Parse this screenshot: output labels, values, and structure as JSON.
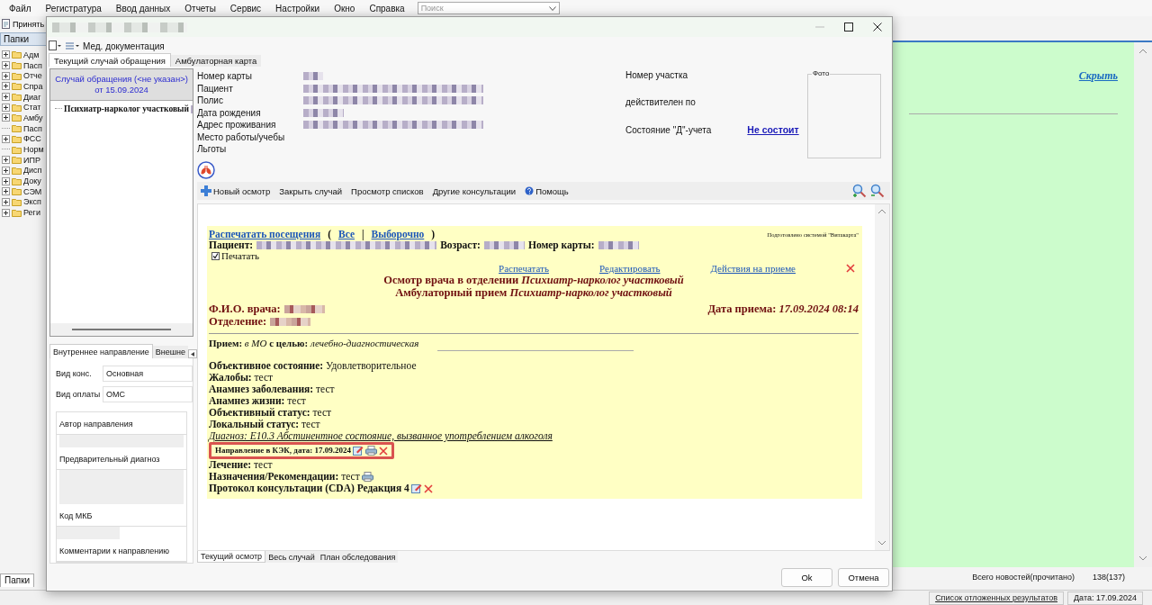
{
  "menu": [
    "Файл",
    "Регистратура",
    "Ввод данных",
    "Отчеты",
    "Сервис",
    "Настройки",
    "Окно",
    "Справка"
  ],
  "search": {
    "placeholder": "Поиск"
  },
  "toolbar": {
    "button": "Принять"
  },
  "folders": {
    "title": "Папки",
    "items": [
      {
        "label": "Адм",
        "expandable": true
      },
      {
        "label": "Пасп",
        "expandable": true
      },
      {
        "label": "Отче",
        "expandable": true
      },
      {
        "label": "Спра",
        "expandable": true
      },
      {
        "label": "Диаг",
        "expandable": true
      },
      {
        "label": "Стат",
        "expandable": true
      },
      {
        "label": "Амбу",
        "expandable": true
      },
      {
        "label": "Пасп",
        "expandable": false
      },
      {
        "label": "ФСС",
        "expandable": true
      },
      {
        "label": "Норм",
        "expandable": false
      },
      {
        "label": "ИПР",
        "expandable": true
      },
      {
        "label": "Дисп",
        "expandable": true
      },
      {
        "label": "Доку",
        "expandable": true
      },
      {
        "label": "СЭМ",
        "expandable": true
      },
      {
        "label": "Эксп",
        "expandable": true
      },
      {
        "label": "Реги",
        "expandable": true
      }
    ]
  },
  "news": {
    "hide_link": "Скрыть",
    "tab": "Папки",
    "total_label": "Всего новостей(прочитано)",
    "total": "138(137)"
  },
  "status_bar": {
    "link": "Список отложенных результатов",
    "date": "Дата: 17.09.2024"
  },
  "dialog": {
    "toolbar_label": "Мед. документация",
    "tabs": [
      {
        "label": "Текущий случай обращения",
        "selected": true
      },
      {
        "label": "Амбулаторная карта",
        "selected": false
      }
    ],
    "case": {
      "header": [
        "Случай обращения (<не указан>)",
        "от 15.09.2024"
      ],
      "item": "Психиатр-нарколог участковый"
    },
    "referral_tabs": [
      {
        "label": "Внутреннее направление",
        "selected": true
      },
      {
        "label": "Внешне",
        "selected": false
      }
    ],
    "referral_fields": [
      {
        "label": "Вид конс.",
        "value": "Основная"
      },
      {
        "label": "Вид оплаты",
        "value": "ОМС"
      }
    ],
    "referral_groups": [
      "Автор направления",
      "Предварительный диагноз",
      "Код МКБ",
      "Комментарии к направлению"
    ],
    "patient_fields": [
      {
        "label": "Номер карты",
        "value_hidden": true
      },
      {
        "label": "Пациент",
        "value_hidden": true
      },
      {
        "label": "Полис",
        "value_hidden": true
      },
      {
        "label": "Дата рождения",
        "value_hidden": true
      },
      {
        "label": "Адрес проживания",
        "value_hidden": true
      },
      {
        "label": "Место работы/учебы",
        "value_hidden": false
      },
      {
        "label": "Льготы",
        "value_hidden": false
      }
    ],
    "district": {
      "number_label": "Номер участка",
      "valid_label": "действителен по",
      "d_status_label": "Состояние \"Д\"-учета",
      "d_status": "Не состоит"
    },
    "photo_label": "Фото",
    "actions": [
      {
        "label": "Новый осмотр",
        "kind": "add"
      },
      {
        "label": "Закрыть случай",
        "kind": "text"
      },
      {
        "label": "Просмотр списков",
        "kind": "text"
      },
      {
        "label": "Другие консультации",
        "kind": "text"
      },
      {
        "label": "Помощь",
        "kind": "help"
      }
    ],
    "document": {
      "print_visits": "Распечатать посещения",
      "paren_open": "(",
      "all": "Все",
      "separator": "|",
      "selective": "Выборочно",
      "paren_close": ")",
      "prepared_by": "Подготовлено системой \"Витакарта\"",
      "patient_labels": [
        "Пациент:",
        "Возраст:",
        "Номер карты:"
      ],
      "print_checkbox": {
        "label": "Печатать",
        "checked": true
      },
      "links": [
        "Распечатать",
        "Редактировать",
        "Действия на приеме"
      ],
      "title_lines": [
        "Осмотр врача в отделении *Психиатр-нарколог участковый*",
        "Амбулаторный прием *Психиатр-нарколог участковый*"
      ],
      "doctor_label": "Ф.И.О. врача:",
      "date": "Дата приема: *17.09.2024 08:14*",
      "department_label": "Отделение:",
      "reception": "**Прием:** *в МО* **с целью:** *лечебно-диагностическая*",
      "entries": [
        {
          "kind": "field",
          "text": "**Объективное состояние:** Удовлетворительное",
          "highlighted": false
        },
        {
          "kind": "field",
          "text": "**Жалобы:** тест",
          "highlighted": false
        },
        {
          "kind": "field",
          "text": "**Анамнез заболевания:** тест",
          "highlighted": false
        },
        {
          "kind": "field",
          "text": "**Анамнез жизни:** тест",
          "highlighted": false
        },
        {
          "kind": "field",
          "text": "**Объективный статус:** тест",
          "highlighted": false
        },
        {
          "kind": "field",
          "text": "**Локальный статус:** тест",
          "highlighted": false
        },
        {
          "kind": "diagnosis",
          "text": "Диагноз: E10.3 Абстинентное состояние, вызванное употреблением алкоголя",
          "highlighted": false
        },
        {
          "kind": "referral",
          "text": "Направление в КЭК, дата: 17.09.2024",
          "highlighted": true
        },
        {
          "kind": "field",
          "text": "**Лечение:** тест",
          "highlighted": false
        },
        {
          "kind": "recommendation",
          "text": "**Назначения/Рекомендации:** тест",
          "highlighted": false
        },
        {
          "kind": "protocol",
          "text": "**Протокол консультации (CDA) Редакция 4**",
          "highlighted": false
        }
      ]
    },
    "bottom_tabs": [
      {
        "label": "Текущий осмотр",
        "selected": true
      },
      {
        "label": "Весь случай",
        "selected": false
      },
      {
        "label": "План обследования",
        "selected": false
      }
    ],
    "buttons": [
      "Ok",
      "Отмена"
    ]
  }
}
